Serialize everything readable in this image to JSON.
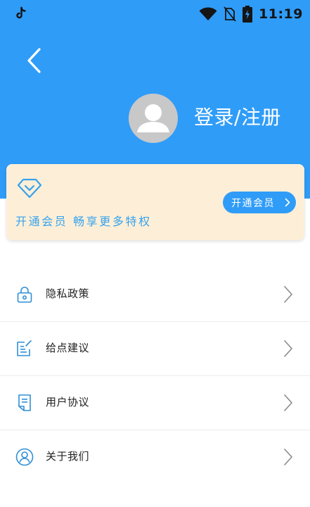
{
  "status_bar": {
    "time": "11:19"
  },
  "icons": {
    "back": "chevron-left-icon",
    "avatar": "user-icon",
    "vip": "diamond-icon",
    "wifi": "wifi-icon",
    "no_sim": "no-sim-icon",
    "battery": "battery-charging-icon",
    "app_notification": "tiktok-icon"
  },
  "profile": {
    "login_label": "登录/注册"
  },
  "vip_card": {
    "slogan": "开通会员  畅享更多特权",
    "button_label": "开通会员"
  },
  "menu": {
    "items": [
      {
        "label": "隐私政策",
        "icon": "lock-icon"
      },
      {
        "label": "给点建议",
        "icon": "edit-icon"
      },
      {
        "label": "用户协议",
        "icon": "document-icon"
      },
      {
        "label": "关于我们",
        "icon": "user-circle-icon"
      }
    ]
  },
  "colors": {
    "primary": "#2f9cf8",
    "vip_card_bg": "#fdefd7",
    "vip_text": "#36a2ee",
    "icon_blue": "#2f8fd6",
    "avatar_bg": "#c8c8c8"
  }
}
